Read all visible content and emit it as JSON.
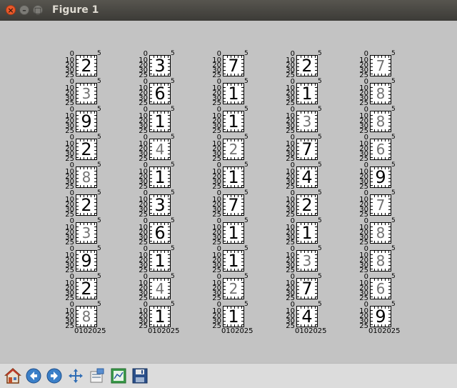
{
  "window": {
    "title": "Figure 1"
  },
  "axis": {
    "y_ticks": [
      "0",
      "10",
      "20",
      "30",
      "25"
    ],
    "x_ticks": "0102025",
    "x_top_tick": "5"
  },
  "grid": {
    "columns": [
      {
        "digits": [
          "2",
          "3",
          "9",
          "2",
          "8",
          "2",
          "3",
          "9",
          "2",
          "8"
        ]
      },
      {
        "digits": [
          "3",
          "6",
          "1",
          "4",
          "1",
          "3",
          "6",
          "1",
          "4",
          "1"
        ]
      },
      {
        "digits": [
          "7",
          "1",
          "1",
          "2",
          "1",
          "7",
          "1",
          "1",
          "2",
          "1"
        ]
      },
      {
        "digits": [
          "2",
          "1",
          "3",
          "7",
          "4",
          "2",
          "1",
          "3",
          "7",
          "4"
        ]
      },
      {
        "digits": [
          "7",
          "8",
          "8",
          "6",
          "9",
          "7",
          "8",
          "8",
          "6",
          "9"
        ]
      }
    ]
  },
  "toolbar": {
    "items": [
      "home-icon",
      "back-icon",
      "forward-icon",
      "pan-icon",
      "zoom-icon",
      "subplots-icon",
      "save-icon"
    ]
  }
}
